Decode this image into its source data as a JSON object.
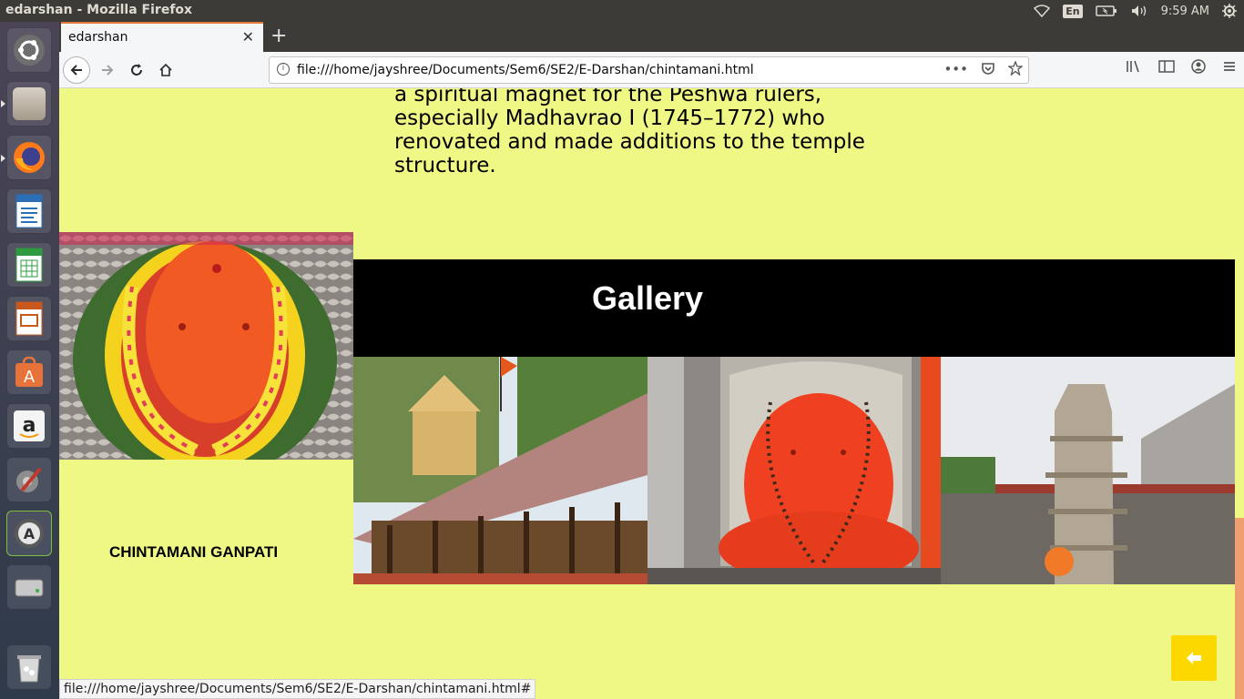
{
  "os": {
    "window_title": "edarshan - Mozilla Firefox",
    "keyboard_layout": "En",
    "clock": "9:59 AM",
    "launcher_apps": [
      "dash-icon",
      "files-icon",
      "firefox-icon",
      "writer-icon",
      "calc-icon",
      "impress-icon",
      "software-center-icon",
      "amazon-icon",
      "settings-icon",
      "software-updater-icon",
      "drive-icon",
      "trash-icon"
    ]
  },
  "browser": {
    "tab_title": "edarshan",
    "url": "file:///home/jayshree/Documents/Sem6/SE2/E-Darshan/chintamani.html",
    "status_url": "file:///home/jayshree/Documents/Sem6/SE2/E-Darshan/chintamani.html#"
  },
  "page": {
    "paragraph_lines": [
      "a spiritual magnet for the Peshwa rulers,",
      "especially Madhavrao I (1745–1772) who",
      "renovated and made additions to the temple",
      "structure."
    ],
    "side_caption": "CHINTAMANI GANPATI",
    "gallery_title": "Gallery",
    "back_button_icon": "arrow-left-icon",
    "colors": {
      "background": "#eff785",
      "gallery_bar": "#000000",
      "back_button": "#fdd800"
    }
  }
}
